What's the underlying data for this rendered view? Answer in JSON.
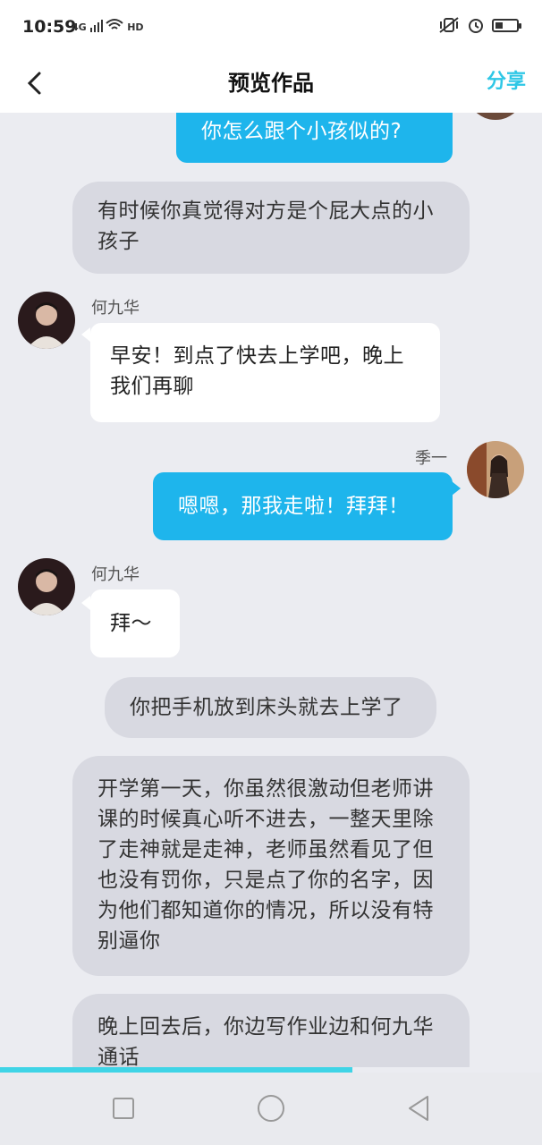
{
  "status_bar": {
    "time": "10:59",
    "network": "4G",
    "hd": "HD"
  },
  "nav": {
    "title": "预览作品",
    "share": "分享"
  },
  "messages": [
    {
      "type": "self",
      "text": "你怎么跟个小孩似的?"
    },
    {
      "type": "narration",
      "text": "有时候你真觉得对方是个屁大点的小孩子"
    },
    {
      "type": "other",
      "sender": "何九华",
      "text": "早安！到点了快去上学吧，晚上我们再聊"
    },
    {
      "type": "self",
      "sender": "季一",
      "text": "嗯嗯，那我走啦！拜拜！"
    },
    {
      "type": "other",
      "sender": "何九华",
      "text": "拜～"
    },
    {
      "type": "narration",
      "text": "你把手机放到床头就去上学了"
    },
    {
      "type": "narration",
      "text": "开学第一天，你虽然很激动但老师讲课的时候真心听不进去，一整天里除了走神就是走神，老师虽然看见了但也没有罚你，只是点了你的名字，因为他们都知道你的情况，所以没有特别逼你"
    },
    {
      "type": "narration",
      "text": "晚上回去后，你边写作业边和何九华通话"
    }
  ],
  "playback_progress": 0.65,
  "colors": {
    "accent": "#2fc7e6",
    "self_bubble": "#1eb5ec",
    "narration_bubble": "#d8d9e1",
    "background": "#ebecf1"
  }
}
